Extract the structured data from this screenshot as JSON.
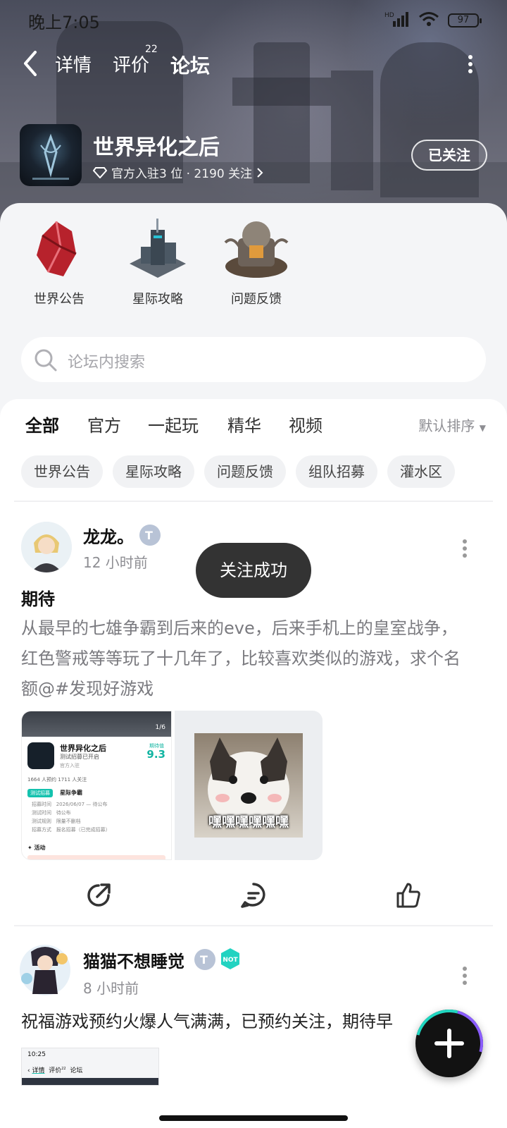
{
  "status_bar": {
    "time": "晚上7:05",
    "network": "HD",
    "battery": "97"
  },
  "nav": {
    "tabs": [
      {
        "label": "详情"
      },
      {
        "label": "评价",
        "badge": "22"
      },
      {
        "label": "论坛",
        "active": true
      }
    ]
  },
  "game": {
    "name": "世界异化之后",
    "meta": "官方入驻3 位 · 2190 关注",
    "follow_label": "已关注"
  },
  "quick_links": [
    {
      "label": "世界公告"
    },
    {
      "label": "星际攻略"
    },
    {
      "label": "问题反馈"
    }
  ],
  "search": {
    "placeholder": "论坛内搜索"
  },
  "filters": {
    "tabs": [
      "全部",
      "官方",
      "一起玩",
      "精华",
      "视频"
    ],
    "sort": "默认排序",
    "chips": [
      "世界公告",
      "星际攻略",
      "问题反馈",
      "组队招募",
      "灌水区"
    ]
  },
  "toast": "关注成功",
  "posts": [
    {
      "user": "龙龙。",
      "time": "12 小时前",
      "title": "期待",
      "body": "从最早的七雄争霸到后来的eve，后来手机上的皇室战争，红色警戒等等玩了十几年了，比较喜欢类似的游戏，求个名额@#发现好游戏",
      "image1": {
        "counter": "1/6",
        "game_name": "世界异化之后",
        "subtitle": "测试招募已开启",
        "official": "官方入驻",
        "expect_label": "期待值",
        "expect_score": "9.3",
        "stats": "1664 人预约  1711 人关注",
        "test_badge": "测试招募",
        "test_name": "星际争霸",
        "rows": [
          {
            "k": "招募时间",
            "v": "2026/06/07 — 待公布"
          },
          {
            "k": "测试时间",
            "v": "待公布"
          },
          {
            "k": "测试规则",
            "v": "限量不删档"
          },
          {
            "k": "招募方式",
            "v": "报名招募（已完成招募）"
          }
        ],
        "activity": "活动"
      },
      "image2": {
        "caption": "嘿嘿嘿嘿嘿嘿"
      }
    },
    {
      "user": "猫猫不想睡觉",
      "time": "8 小时前",
      "badge": "NOT",
      "body": "祝福游戏预约火爆人气满满，已预约关注，期待早",
      "preview": {
        "time": "10:25",
        "tabs": [
          "详情",
          "评价",
          "论坛"
        ],
        "badge": "22"
      }
    }
  ]
}
